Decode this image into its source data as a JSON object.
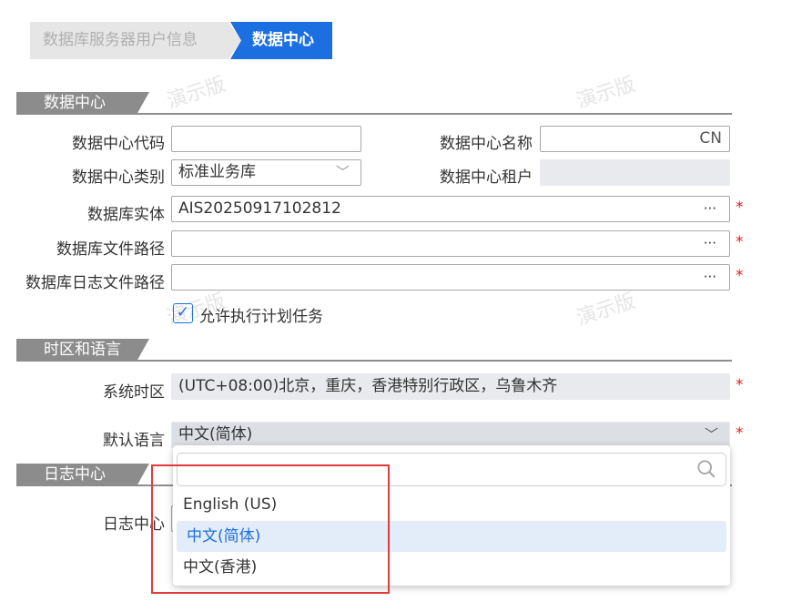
{
  "steps": [
    {
      "label": "数据库服务器用户信息"
    },
    {
      "label": "数据中心"
    }
  ],
  "watermark": "演示版",
  "sections": {
    "datacenter": "数据中心",
    "timezone_lang": "时区和语言",
    "log_center": "日志中心"
  },
  "form": {
    "dc_code_label": "数据中心代码",
    "dc_code_value": "",
    "dc_name_label": "数据中心名称",
    "dc_name_value": "CN",
    "dc_type_label": "数据中心类别",
    "dc_type_value": "标准业务库",
    "dc_tenant_label": "数据中心租户",
    "dc_tenant_value": "",
    "db_entity_label": "数据库实体",
    "db_entity_value": "AIS20250917102812",
    "db_file_path_label": "数据库文件路径",
    "db_file_path_value": "",
    "db_log_path_label": "数据库日志文件路径",
    "db_log_path_value": "",
    "allow_tasks_label": "允许执行计划任务",
    "allow_tasks_checked": true,
    "system_tz_label": "系统时区",
    "system_tz_value": "(UTC+08:00)北京，重庆，香港特别行政区，乌鲁木齐",
    "default_lang_label": "默认语言",
    "default_lang_value": "中文(简体)",
    "log_center_label": "日志中心",
    "ellipsis": "···",
    "required_mark": "*",
    "check_mark": "✓",
    "chevron": "﹀"
  },
  "language_dropdown": {
    "search_value": "",
    "options": [
      {
        "label": "English (US)",
        "selected": false
      },
      {
        "label": "中文(简体)",
        "selected": true
      },
      {
        "label": "中文(香港)",
        "selected": false
      }
    ]
  },
  "colors": {
    "accent": "#1b6fe0",
    "section": "#8c8c8c",
    "required": "#e02020",
    "highlight_box": "#e03a3a"
  }
}
